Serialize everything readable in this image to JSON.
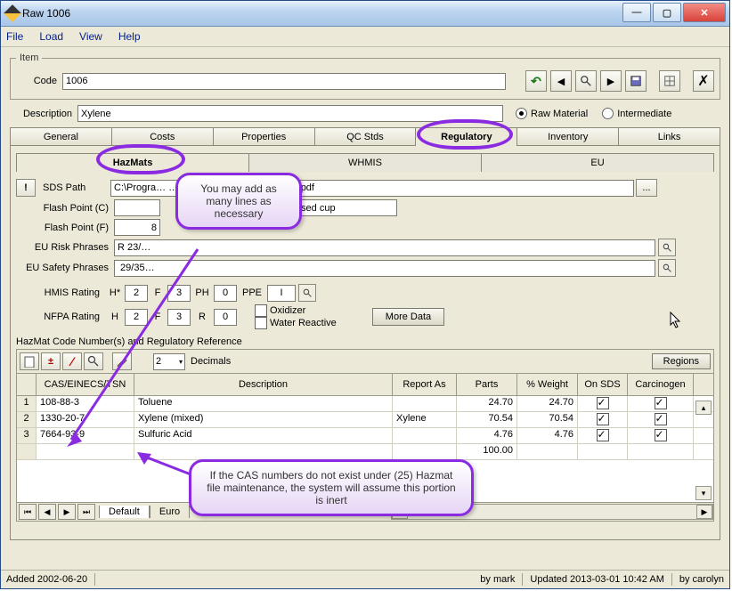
{
  "window": {
    "title": "Raw 1006"
  },
  "menu": {
    "file": "File",
    "load": "Load",
    "view": "View",
    "help": "Help"
  },
  "item": {
    "legend": "Item",
    "code_label": "Code",
    "code": "1006",
    "desc_label": "Description",
    "desc": "Xylene",
    "raw_material": "Raw Material",
    "intermediate": "Intermediate"
  },
  "maintabs": [
    "General",
    "Costs",
    "Properties",
    "QC Stds",
    "Regulatory",
    "Inventory",
    "Links"
  ],
  "subtabs": [
    "HazMats",
    "WHMIS",
    "EU"
  ],
  "hazmat": {
    "warn_btn": "!",
    "sds_label": "SDS Path",
    "sds": "C:\\Progra… …ormulator\\Documents\\iso16.pdf",
    "fpc_label": "Flash Point (C)",
    "fpc": "",
    "fpc_method": "closed cup",
    "fpf_label": "Flash Point (F)",
    "fpf": "8",
    "eur_label": "EU Risk Phrases",
    "eur": "R 23/…",
    "eus_label": "EU Safety Phrases",
    "eus": " 29/35…",
    "hmis_label": "HMIS Rating",
    "nfpa_label": "NFPA Rating",
    "h_lbl": "H*",
    "h_lbl2": "H",
    "f_lbl": "F",
    "ph_lbl": "PH",
    "r_lbl": "R",
    "ppe_lbl": "PPE",
    "hmis_h": "2",
    "hmis_f": "3",
    "hmis_ph": "0",
    "ppe": "I",
    "nfpa_h": "2",
    "nfpa_f": "3",
    "nfpa_r": "0",
    "oxid": "Oxidizer",
    "water": "Water Reactive",
    "more": "More Data"
  },
  "grid": {
    "title": "HazMat Code Number(s) and Regulatory Reference",
    "decimals_val": "2",
    "decimals_lbl": "Decimals",
    "regions": "Regions",
    "headers": {
      "cas": "CAS/EINECS/TSN",
      "desc": "Description",
      "rpt": "Report As",
      "parts": "Parts",
      "wt": "% Weight",
      "sds": "On SDS",
      "carc": "Carcinogen"
    },
    "rows": [
      {
        "n": "1",
        "cas": "108-88-3",
        "desc": "Toluene",
        "rpt": "",
        "parts": "24.70",
        "wt": "24.70",
        "sds": true,
        "carc": true
      },
      {
        "n": "2",
        "cas": "1330-20-7",
        "desc": "Xylene (mixed)",
        "rpt": "Xylene",
        "parts": "70.54",
        "wt": "70.54",
        "sds": true,
        "carc": true
      },
      {
        "n": "3",
        "cas": "7664-93-9",
        "desc": "Sulfuric Acid",
        "rpt": "",
        "parts": "4.76",
        "wt": "4.76",
        "sds": true,
        "carc": true
      }
    ],
    "total_parts": "100.00",
    "sheets": {
      "default": "Default",
      "euro": "Euro"
    }
  },
  "status": {
    "added": "Added 2002-06-20",
    "by1": "by mark",
    "updated": "Updated 2013-03-01 10:42 AM",
    "by2": "by carolyn"
  },
  "callouts": {
    "lines": "You may add as many lines as necessary",
    "inert": "If the CAS numbers do not exist under (25) Hazmat file maintenance, the system will assume this portion is inert"
  }
}
